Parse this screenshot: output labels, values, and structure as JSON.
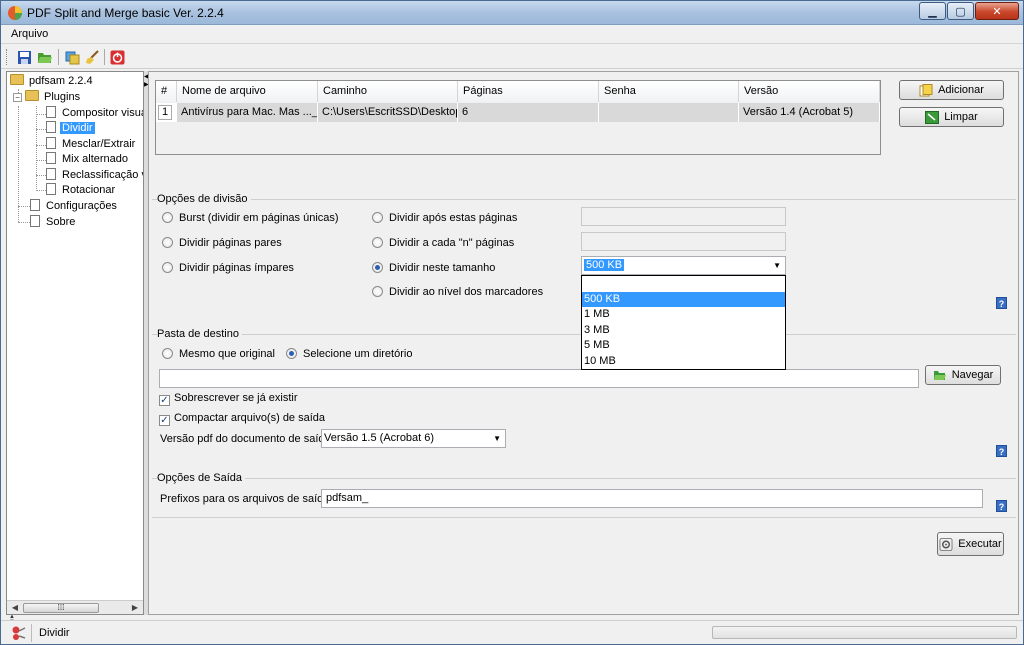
{
  "window": {
    "title": "PDF Split and Merge basic Ver. 2.2.4"
  },
  "menu": {
    "file_label": "Arquivo"
  },
  "toolbar": {
    "icons": [
      "save-icon",
      "open-icon",
      "settings-icon",
      "clear-icon",
      "exit-icon"
    ]
  },
  "tree": {
    "root": "pdfsam 2.2.4",
    "plugins": "Plugins",
    "items": [
      "Compositor visual",
      "Dividir",
      "Mesclar/Extrair",
      "Mix alternado",
      "Reclassificação visual",
      "Rotacionar"
    ],
    "config": "Configurações",
    "about": "Sobre",
    "selected": "Dividir"
  },
  "file_table": {
    "columns": [
      "#",
      "Nome de arquivo",
      "Caminho",
      "Páginas",
      "Senha",
      "Versão"
    ],
    "rows": [
      {
        "index": "1",
        "name": "Antivírus para Mac. Mas ..._ ...",
        "path": "C:\\Users\\EscritSSD\\Desktop...",
        "pages": "6",
        "password": "",
        "version": "Versão 1.4 (Acrobat 5)"
      }
    ]
  },
  "buttons": {
    "add": "Adicionar",
    "clear": "Limpar",
    "browse": "Navegar",
    "run": "Executar"
  },
  "split": {
    "legend": "Opções de divisão",
    "burst": "Burst (dividir em páginas únicas)",
    "even": "Dividir páginas pares",
    "odd": "Dividir páginas ímpares",
    "after": "Dividir após estas páginas",
    "every_n": "Dividir a cada \"n\" páginas",
    "by_size": "Dividir neste tamanho",
    "bookmarks": "Dividir ao nível dos marcadores",
    "selected": "by_size",
    "size_value": "500 KB",
    "size_options": [
      "",
      "500 KB",
      "1 MB",
      "3 MB",
      "5 MB",
      "10 MB"
    ],
    "highlighted_option": "500 KB"
  },
  "destination": {
    "legend": "Pasta de destino",
    "same": "Mesmo que original",
    "choose": "Selecione um diretório",
    "selected": "choose",
    "path_value": "",
    "overwrite": "Sobrescrever se já existir",
    "overwrite_checked": true,
    "compress": "Compactar arquivo(s) de saída",
    "compress_checked": true,
    "version_label": "Versão pdf do documento de saída:",
    "version_value": "Versão 1.5 (Acrobat 6)"
  },
  "output": {
    "legend": "Opções de Saída",
    "prefix_label": "Prefixos para os arquivos de saída:",
    "prefix_value": "pdfsam_"
  },
  "status": {
    "text": "Dividir"
  },
  "colors": {
    "selection": "#3399ff",
    "title_bar": "#a9c2df",
    "close_button": "#c9472a"
  }
}
